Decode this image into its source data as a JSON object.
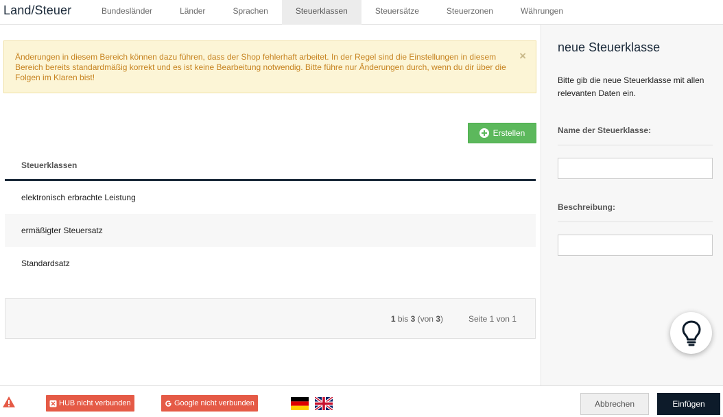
{
  "app": {
    "title": "Land/Steuer"
  },
  "nav": {
    "tabs": [
      {
        "label": "Bundesländer"
      },
      {
        "label": "Länder"
      },
      {
        "label": "Sprachen"
      },
      {
        "label": "Steuerklassen",
        "active": true
      },
      {
        "label": "Steuersätze"
      },
      {
        "label": "Steuerzonen"
      },
      {
        "label": "Währungen"
      }
    ]
  },
  "alert": {
    "text": "Änderungen in diesem Bereich können dazu führen, dass der Shop fehlerhaft arbeitet. In der Regel sind die Einstellungen in diesem Bereich bereits standardmäßig korrekt und es ist keine Bearbeitung notwendig. Bitte führe nur Änderungen durch, wenn du dir über die Folgen im Klaren bist!",
    "close_label": "×"
  },
  "toolbar": {
    "create_label": "Erstellen"
  },
  "table": {
    "header": "Steuerklassen",
    "rows": [
      {
        "name": "elektronisch erbrachte Leistung"
      },
      {
        "name": "ermäßigter Steuersatz"
      },
      {
        "name": "Standardsatz"
      }
    ]
  },
  "pagination": {
    "from": "1",
    "mid": " bis ",
    "to": "3",
    "open": " (von ",
    "total": "3",
    "close": ")",
    "page_text": "Seite 1 von 1"
  },
  "sidebar": {
    "title": "neue Steuerklasse",
    "description": "Bitte gib die neue Steuerklasse mit allen relevanten Daten ein.",
    "fields": [
      {
        "label": "Name der Steuerklasse:",
        "value": "",
        "placeholder": ""
      },
      {
        "label": "Beschreibung:",
        "value": "",
        "placeholder": ""
      }
    ]
  },
  "footer": {
    "hub_status": "HUB nicht verbunden",
    "google_status": "Google nicht verbunden",
    "cancel_label": "Abbrechen",
    "insert_label": "Einfügen"
  },
  "icons": {
    "warning": "warning-icon",
    "hub": "hub-icon",
    "google": "google-icon",
    "lightbulb": "lightbulb-icon",
    "plus": "plus-circle-icon",
    "flag_de": "flag-de-icon",
    "flag_uk": "flag-uk-icon"
  },
  "colors": {
    "primary_dark": "#0d1b2a",
    "success": "#5cb85c",
    "danger": "#e55a46",
    "alert_bg": "#fcf5d6",
    "alert_text": "#c68320"
  }
}
